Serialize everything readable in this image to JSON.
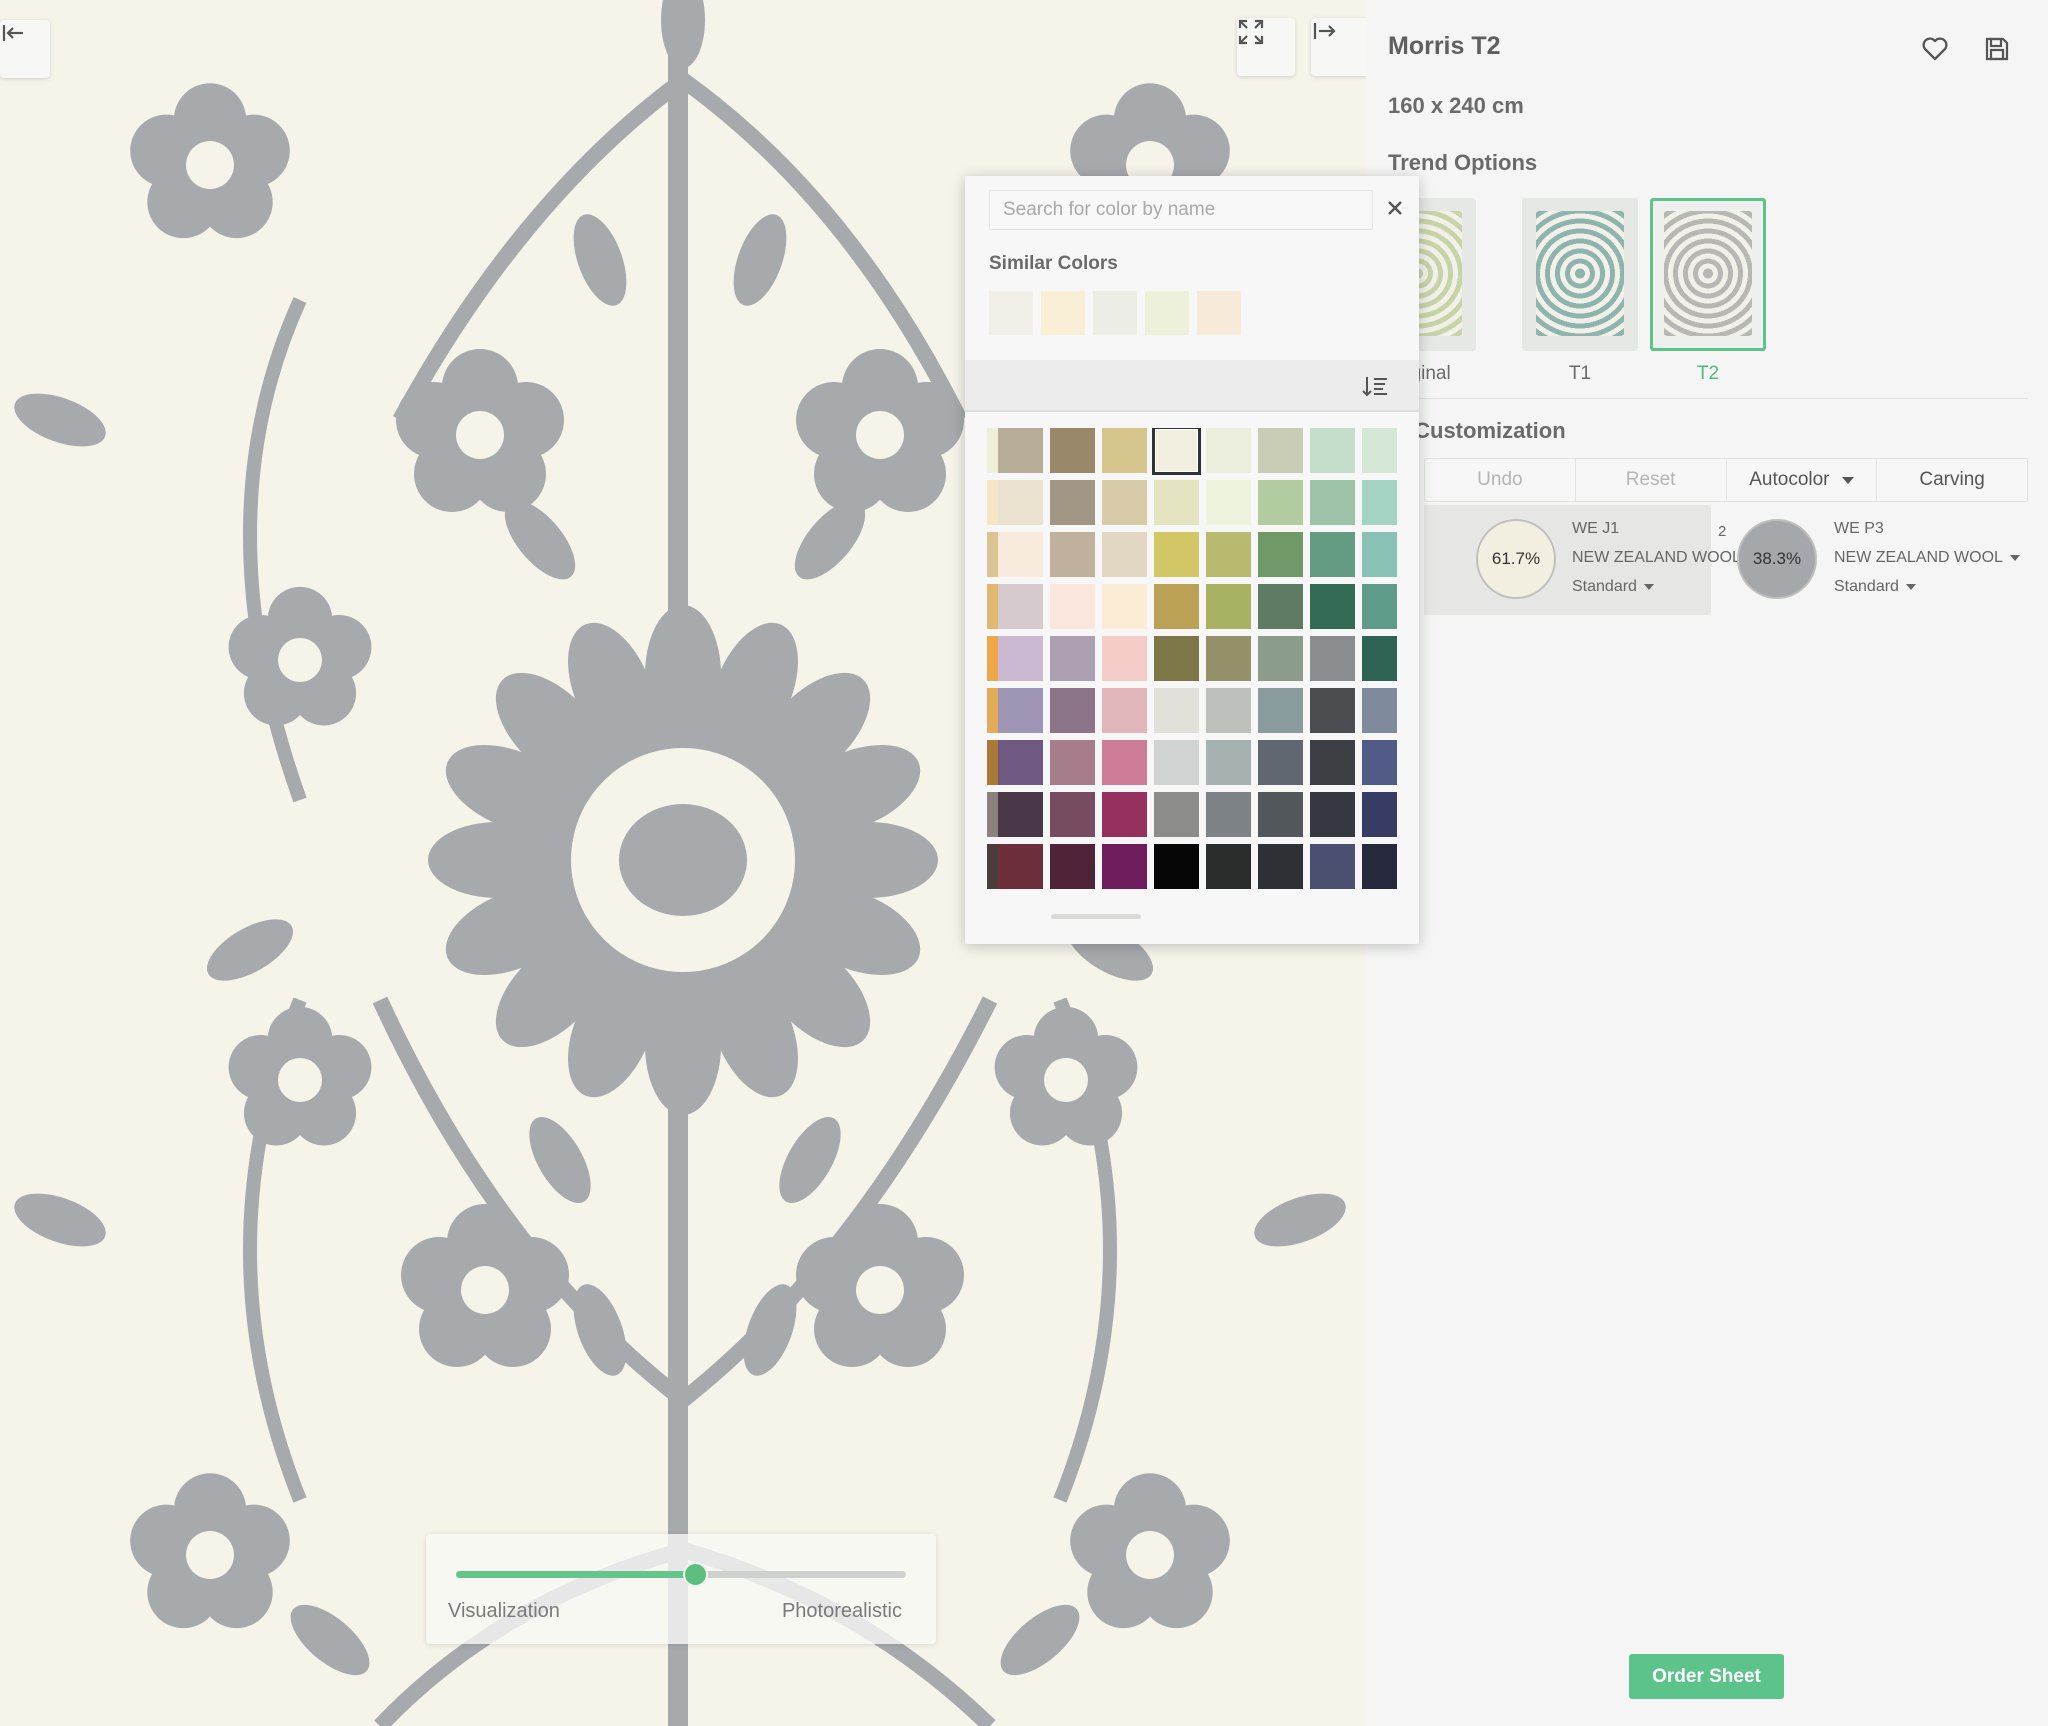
{
  "canvas": {
    "collapse_left_icon": "collapse-left-icon",
    "fullscreen_icon": "fullscreen-icon",
    "expand_right_icon": "expand-right-icon",
    "background_color": "#f6f3e9",
    "pattern_color": "#a6aaad"
  },
  "view_slider": {
    "left_label": "Visualization",
    "right_label": "Photorealistic",
    "value_percent": 53
  },
  "product": {
    "title": "Morris T2",
    "size": "160 x 240 cm",
    "favorite_icon": "heart-icon",
    "save_icon": "save-icon"
  },
  "trend_options": {
    "heading": "Trend Options",
    "items": [
      {
        "label": "Original",
        "selected": false,
        "tint": "#c7d4a8"
      },
      {
        "label": "T1",
        "selected": false,
        "tint": "#8fb3ad"
      },
      {
        "label": "T2",
        "selected": true,
        "tint": "#b7b8b4"
      }
    ]
  },
  "customization": {
    "heading": "or Customization",
    "toolbar": [
      {
        "label": "Undo",
        "disabled": true
      },
      {
        "label": "Reset",
        "disabled": true
      },
      {
        "label": "Autocolor",
        "disabled": false,
        "dropdown": true
      },
      {
        "label": "Carving",
        "disabled": false
      }
    ],
    "colors": [
      {
        "index": "",
        "percent": "61.7%",
        "name": "WE J1",
        "material": "NEW ZEALAND WOOL",
        "grade": "Standard",
        "swatch": "#f3efe0",
        "active": true
      },
      {
        "index": "2",
        "percent": "38.3%",
        "name": "WE P3",
        "material": "NEW ZEALAND WOOL",
        "grade": "Standard",
        "swatch": "#a4a8aa",
        "active": false
      }
    ]
  },
  "order_button": "Order Sheet",
  "color_picker": {
    "search_placeholder": "Search for color by name",
    "search_value": "",
    "close_icon": "close-icon",
    "similar_title": "Similar Colors",
    "similar_colors": [
      "#f1efe7",
      "#f8efd6",
      "#eceee6",
      "#eef1da",
      "#f8ead8"
    ],
    "sort_icon": "sort-icon",
    "selected_swatch": "#f3efe0",
    "palette_rows": [
      [
        "#eff0d8",
        "#b7ad99",
        "#9a886a",
        "#d5c48c",
        "#f3efe0",
        "#ebeedc",
        "#c9cdb5",
        "#c5decb",
        "#d5e8d6"
      ],
      [
        "#f6e5c4",
        "#ebe3cf",
        "#a29785",
        "#d8cba7",
        "#e4e5c0",
        "#edf3dd",
        "#b3cc9f",
        "#9cc3a7",
        "#a5d4c4"
      ],
      [
        "#dbc593",
        "#f8ebdd",
        "#bfb19b",
        "#e1d7c2",
        "#d1c767",
        "#b8ba6f",
        "#6f9966",
        "#639c82",
        "#89c1b4"
      ],
      [
        "#e2b86e",
        "#d7cace",
        "#fbe6dd",
        "#fbecd6",
        "#bba156",
        "#a8b262",
        "#5e7c64",
        "#346b55",
        "#5e9b8b"
      ],
      [
        "#eea84a",
        "#cbb8d1",
        "#ad9fb2",
        "#f3ccc8",
        "#7d7646",
        "#94906a",
        "#8b9d8a",
        "#8a8d8f",
        "#2f6355"
      ],
      [
        "#e4ab59",
        "#9f96b5",
        "#8b7488",
        "#e1b6bb",
        "#e1e0d9",
        "#bec0bc",
        "#8a9b9d",
        "#4c4d51",
        "#7f8a9c"
      ],
      [
        "#aa7938",
        "#6f5882",
        "#a87d8b",
        "#ce7d98",
        "#cfd3d2",
        "#a6b2b2",
        "#616771",
        "#3c3f43",
        "#525b87"
      ],
      [
        "#8b817d",
        "#4a3747",
        "#774c60",
        "#96315f",
        "#8c8d8a",
        "#7d8286",
        "#51575b",
        "#363841",
        "#363c63"
      ],
      [
        "#4a3e3c",
        "#6d2e3b",
        "#4f2438",
        "#6f1c5c",
        "#060606",
        "#2b2d2d",
        "#2d3135",
        "#4b4f70",
        "#262a3c"
      ]
    ]
  }
}
